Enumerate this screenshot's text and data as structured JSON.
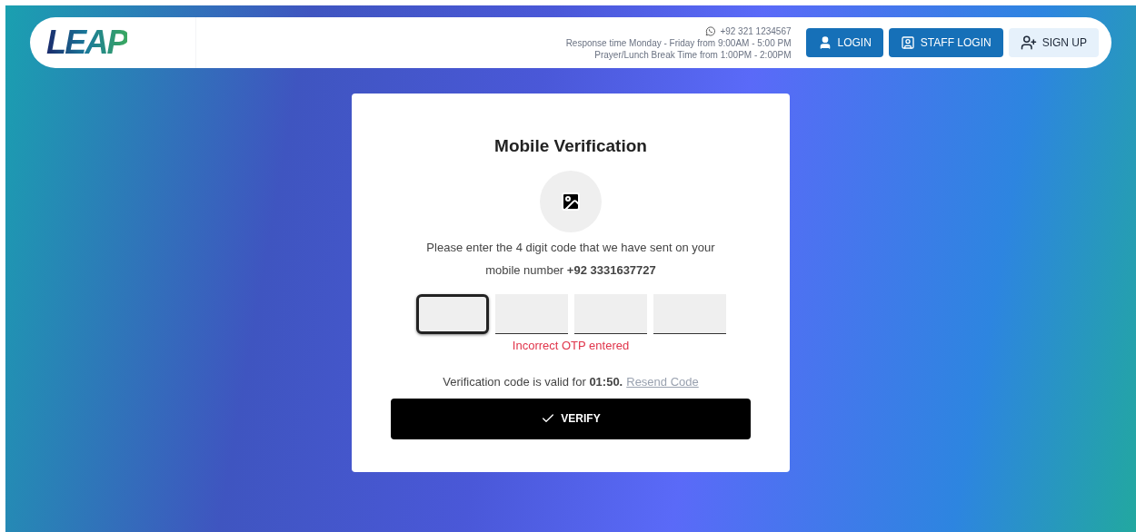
{
  "header": {
    "logo": "LEAP",
    "phone": "+92 321 1234567",
    "hours": "Response time Monday - Friday from 9:00AM - 5:00 PM",
    "break": "Prayer/Lunch Break Time from 1:00PM - 2:00PM",
    "buttons": [
      {
        "label": "LOGIN",
        "kind": "login"
      },
      {
        "label": "STAFF LOGIN",
        "kind": "staff"
      },
      {
        "label": "SIGN UP",
        "kind": "signup"
      }
    ]
  },
  "card": {
    "title": "Mobile Verification",
    "message": "Please enter the 4 digit code that we have sent on your mobile number **+92 3331637727**",
    "otp_fields": [
      {
        "focused": true
      },
      {
        "focused": false
      },
      {
        "focused": false
      },
      {
        "focused": false
      }
    ],
    "error": "Incorrect OTP entered",
    "validity": "Verification code is valid for **01:50.**",
    "resend": "Resend Code",
    "verify": "VERIFY"
  }
}
